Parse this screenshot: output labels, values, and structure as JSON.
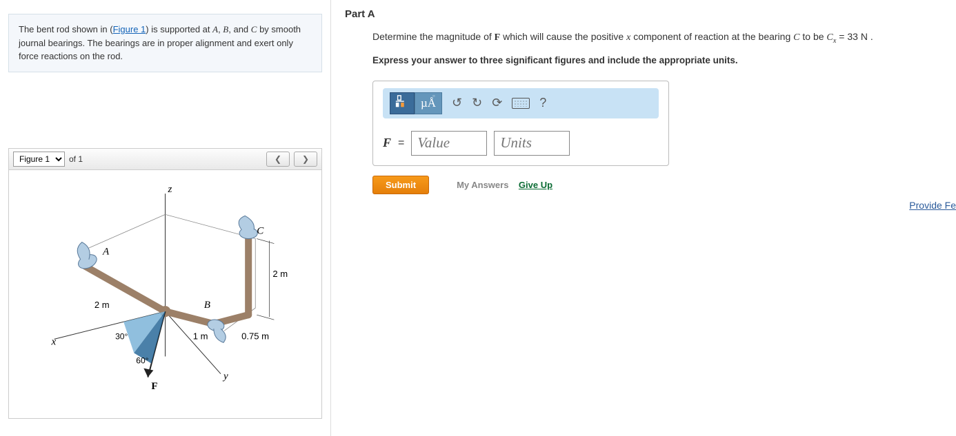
{
  "problem": {
    "text_prefix": "The bent rod shown in (",
    "figure_link": "Figure 1",
    "text_mid": ") is supported at ",
    "pA": "A",
    "comma1": ", ",
    "pB": "B",
    "comma2": ", and ",
    "pC": "C",
    "text_suffix": " by smooth journal bearings. The bearings are in proper alignment and exert only force reactions on the rod."
  },
  "figure": {
    "selector": "Figure 1",
    "of_label": "of 1",
    "labels": {
      "z": "z",
      "x": "x",
      "y": "y",
      "A": "A",
      "B": "B",
      "C": "C",
      "F": "F",
      "d2m_a": "2 m",
      "d2m_b": "2 m",
      "d1m": "1 m",
      "d075": "0.75 m",
      "a30": "30°",
      "a60": "60°"
    }
  },
  "part": {
    "label": "Part A"
  },
  "question": {
    "prefix": "Determine the magnitude of ",
    "Fbold": "F",
    "mid1": " which will cause the positive ",
    "xvar": "x",
    "mid2": " component of reaction at the bearing ",
    "Cpt": "C",
    "mid3": " to be ",
    "Cx": "C",
    "xsub": "x",
    "eqtxt": " = 33  N ."
  },
  "instruction": "Express your answer to three significant figures and include the appropriate units.",
  "toolbar": {
    "mu_label": "µÅ",
    "help": "?"
  },
  "answer": {
    "Flabel": "F",
    "eq": "=",
    "value_ph": "Value",
    "units_ph": "Units"
  },
  "buttons": {
    "submit": "Submit",
    "myanswers": "My Answers",
    "giveup": "Give Up"
  },
  "feedback_link": "Provide Fe"
}
